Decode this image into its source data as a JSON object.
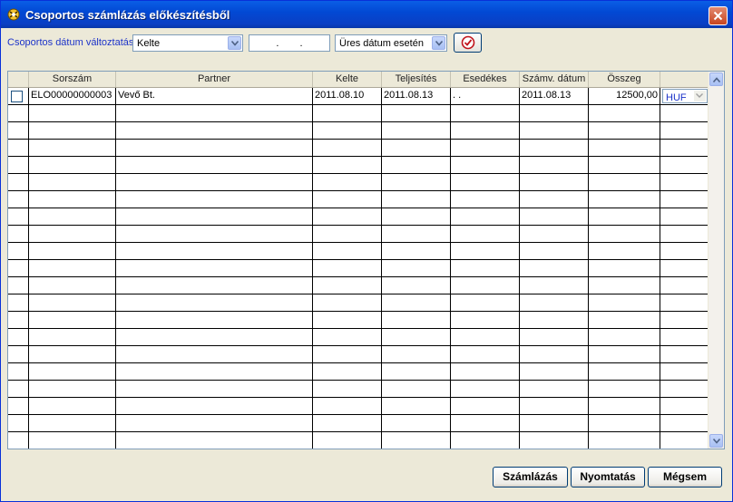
{
  "window": {
    "title": "Csoportos számlázás előkészítésből"
  },
  "filter": {
    "label": "Csoportos dátum változtatás",
    "date_field": "Kelte",
    "date_value": ". .",
    "mode": "Üres dátum esetén"
  },
  "grid": {
    "columns": [
      "",
      "Sorszám",
      "Partner",
      "Kelte",
      "Teljesítés",
      "Esedékes",
      "Számv. dátum",
      "Összeg",
      ""
    ],
    "rows": [
      {
        "checked": false,
        "sorszam": "ELO00000000003",
        "partner": "Vevő Bt.",
        "kelte": "2011.08.10",
        "teljesites": "2011.08.13",
        "esedekes": ". .",
        "szamv_datum": "2011.08.13",
        "osszeg": "12500,00",
        "currency": "HUF"
      }
    ],
    "empty_rows": 20
  },
  "buttons": {
    "invoice": "Számlázás",
    "print": "Nyomtatás",
    "cancel": "Mégsem"
  }
}
